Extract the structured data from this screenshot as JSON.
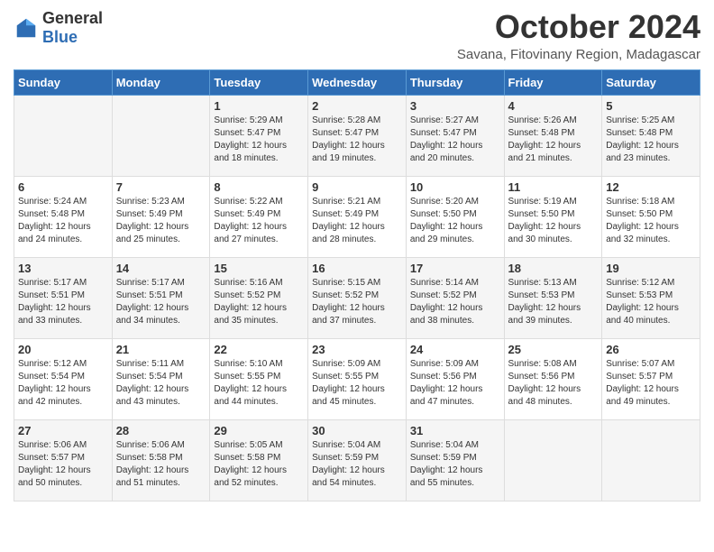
{
  "logo": {
    "general": "General",
    "blue": "Blue"
  },
  "header": {
    "month": "October 2024",
    "location": "Savana, Fitovinany Region, Madagascar"
  },
  "weekdays": [
    "Sunday",
    "Monday",
    "Tuesday",
    "Wednesday",
    "Thursday",
    "Friday",
    "Saturday"
  ],
  "weeks": [
    [
      {
        "day": "",
        "sunrise": "",
        "sunset": "",
        "daylight": ""
      },
      {
        "day": "",
        "sunrise": "",
        "sunset": "",
        "daylight": ""
      },
      {
        "day": "1",
        "sunrise": "Sunrise: 5:29 AM",
        "sunset": "Sunset: 5:47 PM",
        "daylight": "Daylight: 12 hours and 18 minutes."
      },
      {
        "day": "2",
        "sunrise": "Sunrise: 5:28 AM",
        "sunset": "Sunset: 5:47 PM",
        "daylight": "Daylight: 12 hours and 19 minutes."
      },
      {
        "day": "3",
        "sunrise": "Sunrise: 5:27 AM",
        "sunset": "Sunset: 5:47 PM",
        "daylight": "Daylight: 12 hours and 20 minutes."
      },
      {
        "day": "4",
        "sunrise": "Sunrise: 5:26 AM",
        "sunset": "Sunset: 5:48 PM",
        "daylight": "Daylight: 12 hours and 21 minutes."
      },
      {
        "day": "5",
        "sunrise": "Sunrise: 5:25 AM",
        "sunset": "Sunset: 5:48 PM",
        "daylight": "Daylight: 12 hours and 23 minutes."
      }
    ],
    [
      {
        "day": "6",
        "sunrise": "Sunrise: 5:24 AM",
        "sunset": "Sunset: 5:48 PM",
        "daylight": "Daylight: 12 hours and 24 minutes."
      },
      {
        "day": "7",
        "sunrise": "Sunrise: 5:23 AM",
        "sunset": "Sunset: 5:49 PM",
        "daylight": "Daylight: 12 hours and 25 minutes."
      },
      {
        "day": "8",
        "sunrise": "Sunrise: 5:22 AM",
        "sunset": "Sunset: 5:49 PM",
        "daylight": "Daylight: 12 hours and 27 minutes."
      },
      {
        "day": "9",
        "sunrise": "Sunrise: 5:21 AM",
        "sunset": "Sunset: 5:49 PM",
        "daylight": "Daylight: 12 hours and 28 minutes."
      },
      {
        "day": "10",
        "sunrise": "Sunrise: 5:20 AM",
        "sunset": "Sunset: 5:50 PM",
        "daylight": "Daylight: 12 hours and 29 minutes."
      },
      {
        "day": "11",
        "sunrise": "Sunrise: 5:19 AM",
        "sunset": "Sunset: 5:50 PM",
        "daylight": "Daylight: 12 hours and 30 minutes."
      },
      {
        "day": "12",
        "sunrise": "Sunrise: 5:18 AM",
        "sunset": "Sunset: 5:50 PM",
        "daylight": "Daylight: 12 hours and 32 minutes."
      }
    ],
    [
      {
        "day": "13",
        "sunrise": "Sunrise: 5:17 AM",
        "sunset": "Sunset: 5:51 PM",
        "daylight": "Daylight: 12 hours and 33 minutes."
      },
      {
        "day": "14",
        "sunrise": "Sunrise: 5:17 AM",
        "sunset": "Sunset: 5:51 PM",
        "daylight": "Daylight: 12 hours and 34 minutes."
      },
      {
        "day": "15",
        "sunrise": "Sunrise: 5:16 AM",
        "sunset": "Sunset: 5:52 PM",
        "daylight": "Daylight: 12 hours and 35 minutes."
      },
      {
        "day": "16",
        "sunrise": "Sunrise: 5:15 AM",
        "sunset": "Sunset: 5:52 PM",
        "daylight": "Daylight: 12 hours and 37 minutes."
      },
      {
        "day": "17",
        "sunrise": "Sunrise: 5:14 AM",
        "sunset": "Sunset: 5:52 PM",
        "daylight": "Daylight: 12 hours and 38 minutes."
      },
      {
        "day": "18",
        "sunrise": "Sunrise: 5:13 AM",
        "sunset": "Sunset: 5:53 PM",
        "daylight": "Daylight: 12 hours and 39 minutes."
      },
      {
        "day": "19",
        "sunrise": "Sunrise: 5:12 AM",
        "sunset": "Sunset: 5:53 PM",
        "daylight": "Daylight: 12 hours and 40 minutes."
      }
    ],
    [
      {
        "day": "20",
        "sunrise": "Sunrise: 5:12 AM",
        "sunset": "Sunset: 5:54 PM",
        "daylight": "Daylight: 12 hours and 42 minutes."
      },
      {
        "day": "21",
        "sunrise": "Sunrise: 5:11 AM",
        "sunset": "Sunset: 5:54 PM",
        "daylight": "Daylight: 12 hours and 43 minutes."
      },
      {
        "day": "22",
        "sunrise": "Sunrise: 5:10 AM",
        "sunset": "Sunset: 5:55 PM",
        "daylight": "Daylight: 12 hours and 44 minutes."
      },
      {
        "day": "23",
        "sunrise": "Sunrise: 5:09 AM",
        "sunset": "Sunset: 5:55 PM",
        "daylight": "Daylight: 12 hours and 45 minutes."
      },
      {
        "day": "24",
        "sunrise": "Sunrise: 5:09 AM",
        "sunset": "Sunset: 5:56 PM",
        "daylight": "Daylight: 12 hours and 47 minutes."
      },
      {
        "day": "25",
        "sunrise": "Sunrise: 5:08 AM",
        "sunset": "Sunset: 5:56 PM",
        "daylight": "Daylight: 12 hours and 48 minutes."
      },
      {
        "day": "26",
        "sunrise": "Sunrise: 5:07 AM",
        "sunset": "Sunset: 5:57 PM",
        "daylight": "Daylight: 12 hours and 49 minutes."
      }
    ],
    [
      {
        "day": "27",
        "sunrise": "Sunrise: 5:06 AM",
        "sunset": "Sunset: 5:57 PM",
        "daylight": "Daylight: 12 hours and 50 minutes."
      },
      {
        "day": "28",
        "sunrise": "Sunrise: 5:06 AM",
        "sunset": "Sunset: 5:58 PM",
        "daylight": "Daylight: 12 hours and 51 minutes."
      },
      {
        "day": "29",
        "sunrise": "Sunrise: 5:05 AM",
        "sunset": "Sunset: 5:58 PM",
        "daylight": "Daylight: 12 hours and 52 minutes."
      },
      {
        "day": "30",
        "sunrise": "Sunrise: 5:04 AM",
        "sunset": "Sunset: 5:59 PM",
        "daylight": "Daylight: 12 hours and 54 minutes."
      },
      {
        "day": "31",
        "sunrise": "Sunrise: 5:04 AM",
        "sunset": "Sunset: 5:59 PM",
        "daylight": "Daylight: 12 hours and 55 minutes."
      },
      {
        "day": "",
        "sunrise": "",
        "sunset": "",
        "daylight": ""
      },
      {
        "day": "",
        "sunrise": "",
        "sunset": "",
        "daylight": ""
      }
    ]
  ]
}
